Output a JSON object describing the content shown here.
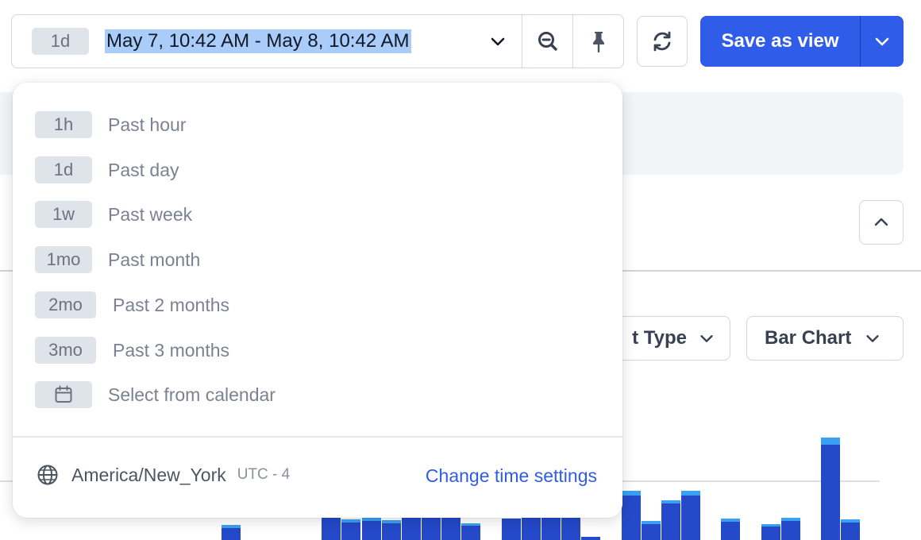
{
  "time_picker": {
    "badge": "1d",
    "range": "May 7, 10:42 AM - May 8, 10:42 AM"
  },
  "save_view": {
    "label": "Save as view"
  },
  "controls": {
    "event_type_label": "t Type",
    "chart_type_label": "Bar Chart"
  },
  "dropdown": {
    "options": [
      {
        "badge": "1h",
        "label": "Past hour"
      },
      {
        "badge": "1d",
        "label": "Past day"
      },
      {
        "badge": "1w",
        "label": "Past week"
      },
      {
        "badge": "1mo",
        "label": "Past month"
      },
      {
        "badge": "2mo",
        "label": "Past 2 months"
      },
      {
        "badge": "3mo",
        "label": "Past 3 months"
      },
      {
        "badge_icon": "calendar-icon",
        "label": "Select from calendar"
      }
    ],
    "timezone": {
      "icon": "globe-icon",
      "name": "America/New_York",
      "offset": "UTC - 4"
    },
    "change_link": "Change time settings"
  },
  "colors": {
    "accent": "#2f5ce8",
    "selection": "#a9ccf8",
    "bar_primary": "#2449c9",
    "bar_secondary": "#4a73ec",
    "bar_top": "#3aa0f2"
  },
  "chart_data": {
    "type": "bar",
    "stacked": true,
    "note_visible": "partially hidden behind dropdown",
    "series": [
      {
        "values": [
          15,
          30,
          22,
          24,
          21,
          30,
          30,
          30,
          18,
          27,
          30,
          30,
          30,
          4,
          56,
          20,
          46,
          56,
          23,
          17,
          24,
          120,
          22
        ]
      },
      {
        "values": [
          4,
          4,
          4,
          4,
          4,
          0,
          0,
          0,
          3,
          0,
          0,
          0,
          0,
          0,
          6,
          4,
          4,
          6,
          4,
          3,
          4,
          9,
          4
        ]
      }
    ]
  }
}
